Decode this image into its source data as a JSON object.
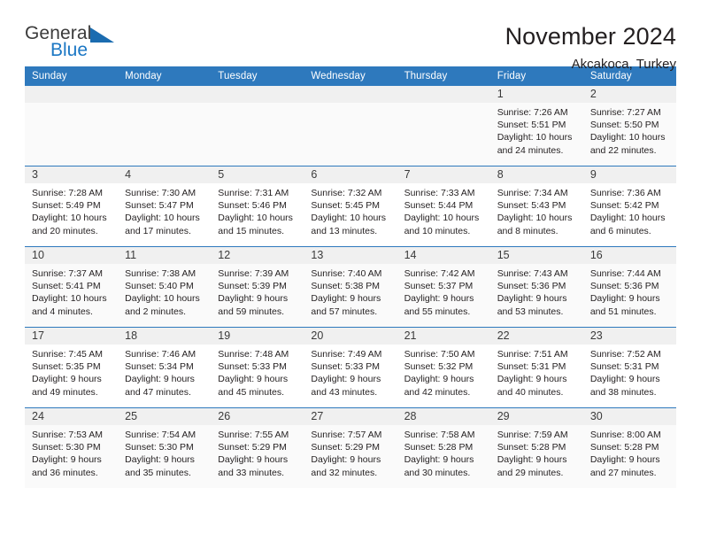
{
  "brand": {
    "name_part1": "General",
    "name_part2": "Blue",
    "accent_color": "#1b77c4",
    "triangle_color": "#1b6cb0"
  },
  "header": {
    "title": "November 2024",
    "subtitle": "Akcakoca, Turkey"
  },
  "calendar": {
    "header_bg": "#2e79bd",
    "weekdays": [
      "Sunday",
      "Monday",
      "Tuesday",
      "Wednesday",
      "Thursday",
      "Friday",
      "Saturday"
    ],
    "weeks": [
      [
        {
          "day": "",
          "sunrise": "",
          "sunset": "",
          "daylight": "",
          "daylight2": ""
        },
        {
          "day": "",
          "sunrise": "",
          "sunset": "",
          "daylight": "",
          "daylight2": ""
        },
        {
          "day": "",
          "sunrise": "",
          "sunset": "",
          "daylight": "",
          "daylight2": ""
        },
        {
          "day": "",
          "sunrise": "",
          "sunset": "",
          "daylight": "",
          "daylight2": ""
        },
        {
          "day": "",
          "sunrise": "",
          "sunset": "",
          "daylight": "",
          "daylight2": ""
        },
        {
          "day": "1",
          "sunrise": "Sunrise: 7:26 AM",
          "sunset": "Sunset: 5:51 PM",
          "daylight": "Daylight: 10 hours",
          "daylight2": "and 24 minutes."
        },
        {
          "day": "2",
          "sunrise": "Sunrise: 7:27 AM",
          "sunset": "Sunset: 5:50 PM",
          "daylight": "Daylight: 10 hours",
          "daylight2": "and 22 minutes."
        }
      ],
      [
        {
          "day": "3",
          "sunrise": "Sunrise: 7:28 AM",
          "sunset": "Sunset: 5:49 PM",
          "daylight": "Daylight: 10 hours",
          "daylight2": "and 20 minutes."
        },
        {
          "day": "4",
          "sunrise": "Sunrise: 7:30 AM",
          "sunset": "Sunset: 5:47 PM",
          "daylight": "Daylight: 10 hours",
          "daylight2": "and 17 minutes."
        },
        {
          "day": "5",
          "sunrise": "Sunrise: 7:31 AM",
          "sunset": "Sunset: 5:46 PM",
          "daylight": "Daylight: 10 hours",
          "daylight2": "and 15 minutes."
        },
        {
          "day": "6",
          "sunrise": "Sunrise: 7:32 AM",
          "sunset": "Sunset: 5:45 PM",
          "daylight": "Daylight: 10 hours",
          "daylight2": "and 13 minutes."
        },
        {
          "day": "7",
          "sunrise": "Sunrise: 7:33 AM",
          "sunset": "Sunset: 5:44 PM",
          "daylight": "Daylight: 10 hours",
          "daylight2": "and 10 minutes."
        },
        {
          "day": "8",
          "sunrise": "Sunrise: 7:34 AM",
          "sunset": "Sunset: 5:43 PM",
          "daylight": "Daylight: 10 hours",
          "daylight2": "and 8 minutes."
        },
        {
          "day": "9",
          "sunrise": "Sunrise: 7:36 AM",
          "sunset": "Sunset: 5:42 PM",
          "daylight": "Daylight: 10 hours",
          "daylight2": "and 6 minutes."
        }
      ],
      [
        {
          "day": "10",
          "sunrise": "Sunrise: 7:37 AM",
          "sunset": "Sunset: 5:41 PM",
          "daylight": "Daylight: 10 hours",
          "daylight2": "and 4 minutes."
        },
        {
          "day": "11",
          "sunrise": "Sunrise: 7:38 AM",
          "sunset": "Sunset: 5:40 PM",
          "daylight": "Daylight: 10 hours",
          "daylight2": "and 2 minutes."
        },
        {
          "day": "12",
          "sunrise": "Sunrise: 7:39 AM",
          "sunset": "Sunset: 5:39 PM",
          "daylight": "Daylight: 9 hours",
          "daylight2": "and 59 minutes."
        },
        {
          "day": "13",
          "sunrise": "Sunrise: 7:40 AM",
          "sunset": "Sunset: 5:38 PM",
          "daylight": "Daylight: 9 hours",
          "daylight2": "and 57 minutes."
        },
        {
          "day": "14",
          "sunrise": "Sunrise: 7:42 AM",
          "sunset": "Sunset: 5:37 PM",
          "daylight": "Daylight: 9 hours",
          "daylight2": "and 55 minutes."
        },
        {
          "day": "15",
          "sunrise": "Sunrise: 7:43 AM",
          "sunset": "Sunset: 5:36 PM",
          "daylight": "Daylight: 9 hours",
          "daylight2": "and 53 minutes."
        },
        {
          "day": "16",
          "sunrise": "Sunrise: 7:44 AM",
          "sunset": "Sunset: 5:36 PM",
          "daylight": "Daylight: 9 hours",
          "daylight2": "and 51 minutes."
        }
      ],
      [
        {
          "day": "17",
          "sunrise": "Sunrise: 7:45 AM",
          "sunset": "Sunset: 5:35 PM",
          "daylight": "Daylight: 9 hours",
          "daylight2": "and 49 minutes."
        },
        {
          "day": "18",
          "sunrise": "Sunrise: 7:46 AM",
          "sunset": "Sunset: 5:34 PM",
          "daylight": "Daylight: 9 hours",
          "daylight2": "and 47 minutes."
        },
        {
          "day": "19",
          "sunrise": "Sunrise: 7:48 AM",
          "sunset": "Sunset: 5:33 PM",
          "daylight": "Daylight: 9 hours",
          "daylight2": "and 45 minutes."
        },
        {
          "day": "20",
          "sunrise": "Sunrise: 7:49 AM",
          "sunset": "Sunset: 5:33 PM",
          "daylight": "Daylight: 9 hours",
          "daylight2": "and 43 minutes."
        },
        {
          "day": "21",
          "sunrise": "Sunrise: 7:50 AM",
          "sunset": "Sunset: 5:32 PM",
          "daylight": "Daylight: 9 hours",
          "daylight2": "and 42 minutes."
        },
        {
          "day": "22",
          "sunrise": "Sunrise: 7:51 AM",
          "sunset": "Sunset: 5:31 PM",
          "daylight": "Daylight: 9 hours",
          "daylight2": "and 40 minutes."
        },
        {
          "day": "23",
          "sunrise": "Sunrise: 7:52 AM",
          "sunset": "Sunset: 5:31 PM",
          "daylight": "Daylight: 9 hours",
          "daylight2": "and 38 minutes."
        }
      ],
      [
        {
          "day": "24",
          "sunrise": "Sunrise: 7:53 AM",
          "sunset": "Sunset: 5:30 PM",
          "daylight": "Daylight: 9 hours",
          "daylight2": "and 36 minutes."
        },
        {
          "day": "25",
          "sunrise": "Sunrise: 7:54 AM",
          "sunset": "Sunset: 5:30 PM",
          "daylight": "Daylight: 9 hours",
          "daylight2": "and 35 minutes."
        },
        {
          "day": "26",
          "sunrise": "Sunrise: 7:55 AM",
          "sunset": "Sunset: 5:29 PM",
          "daylight": "Daylight: 9 hours",
          "daylight2": "and 33 minutes."
        },
        {
          "day": "27",
          "sunrise": "Sunrise: 7:57 AM",
          "sunset": "Sunset: 5:29 PM",
          "daylight": "Daylight: 9 hours",
          "daylight2": "and 32 minutes."
        },
        {
          "day": "28",
          "sunrise": "Sunrise: 7:58 AM",
          "sunset": "Sunset: 5:28 PM",
          "daylight": "Daylight: 9 hours",
          "daylight2": "and 30 minutes."
        },
        {
          "day": "29",
          "sunrise": "Sunrise: 7:59 AM",
          "sunset": "Sunset: 5:28 PM",
          "daylight": "Daylight: 9 hours",
          "daylight2": "and 29 minutes."
        },
        {
          "day": "30",
          "sunrise": "Sunrise: 8:00 AM",
          "sunset": "Sunset: 5:28 PM",
          "daylight": "Daylight: 9 hours",
          "daylight2": "and 27 minutes."
        }
      ]
    ]
  }
}
